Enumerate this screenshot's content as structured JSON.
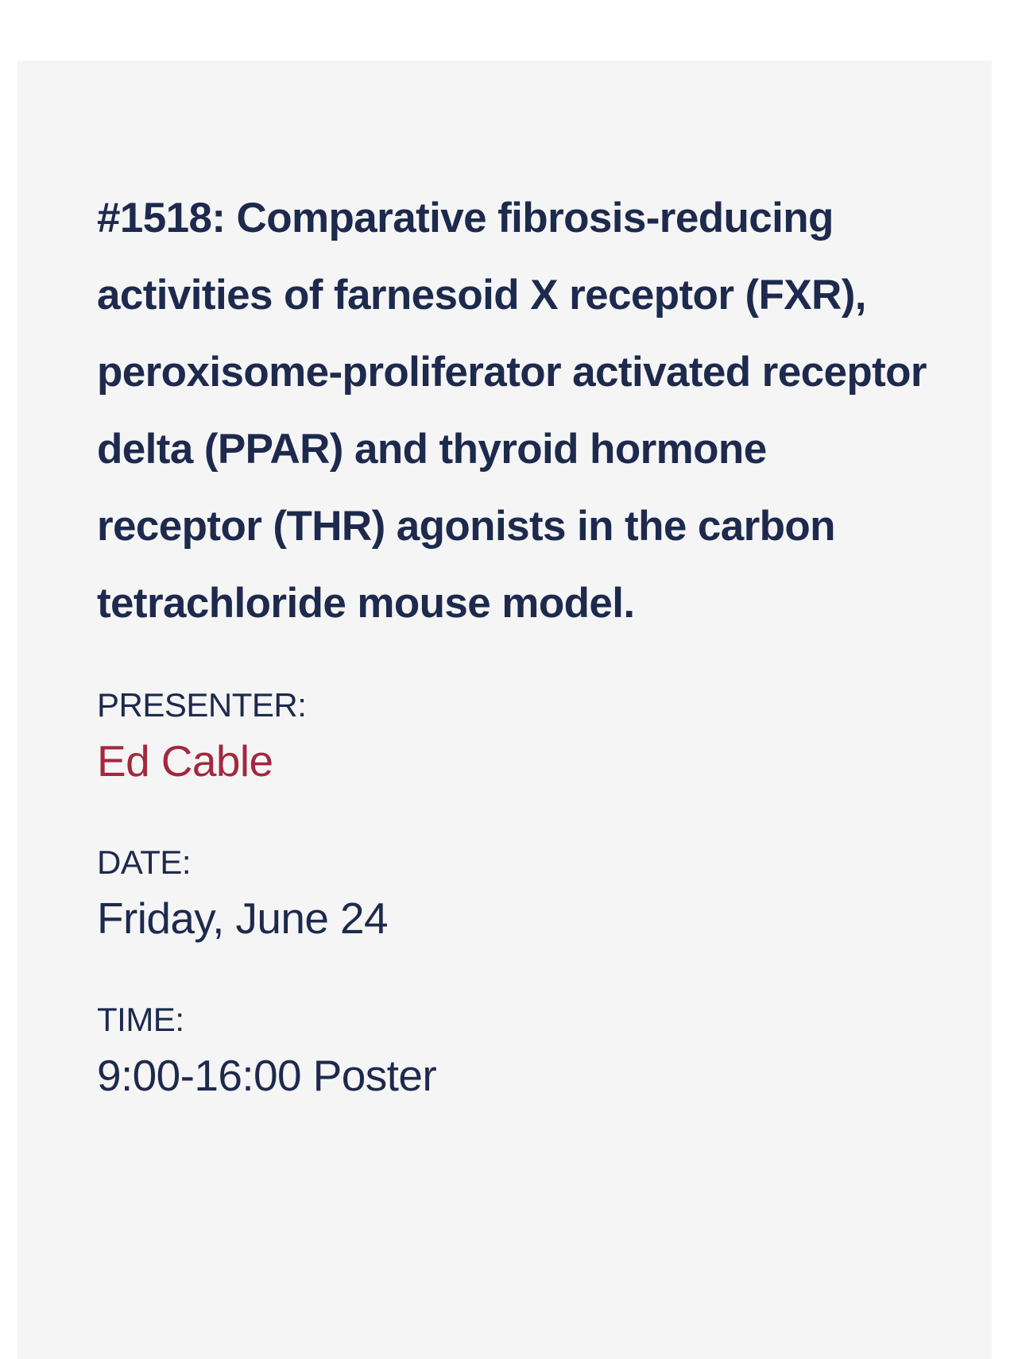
{
  "session": {
    "title": "#1518: Comparative fibrosis-reducing activities of farnesoid X receptor (FXR), peroxisome-proliferator activated receptor delta (PPAR) and thyroid hormone receptor (THR) agonists in the carbon tetrachloride mouse model.",
    "presenter_label": "PRESENTER:",
    "presenter_name": "Ed Cable",
    "date_label": "DATE:",
    "date_value": "Friday, June 24",
    "time_label": "TIME:",
    "time_value": "9:00-16:00 Poster"
  },
  "colors": {
    "text": "#1d2a4d",
    "presenter_link": "#a3283f",
    "card_background": "#f5f5f6"
  }
}
